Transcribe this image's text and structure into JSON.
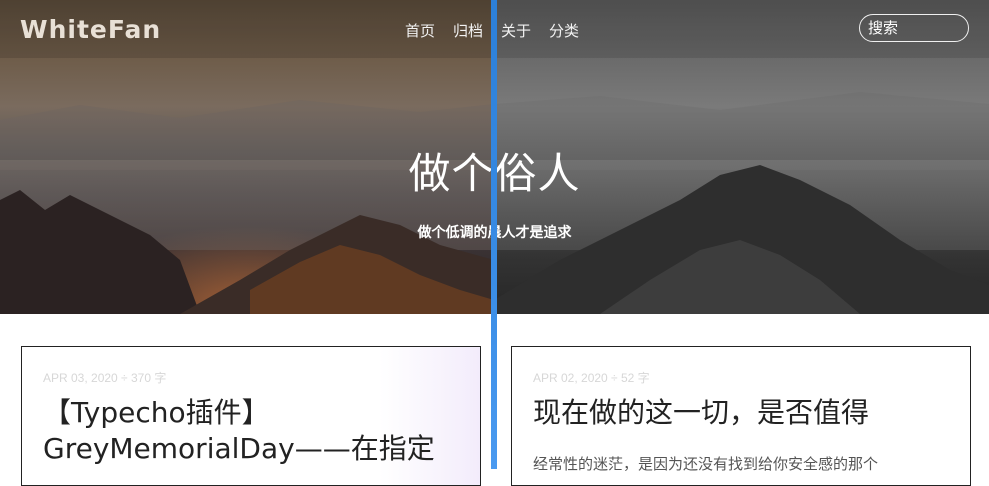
{
  "header": {
    "logo": "WhiteFan",
    "nav": [
      "首页",
      "归档",
      "关于",
      "分类"
    ],
    "search_placeholder": "搜索"
  },
  "hero": {
    "title": "做个俗人",
    "subtitle": "做个低调的晨人才是追求"
  },
  "posts": [
    {
      "meta": "APR 03, 2020 ÷ 370 字",
      "title": "【Typecho插件】GreyMemorialDay——在指定",
      "excerpt": ""
    },
    {
      "meta": "APR 02, 2020 ÷ 52 字",
      "title": "现在做的这一切，是否值得",
      "excerpt": "经常性的迷茫，是因为还没有找到给你安全感的那个"
    }
  ],
  "colors": {
    "divider": "#2c7fd8",
    "card_border": "#222222",
    "meta_text": "#d7d7d7"
  }
}
